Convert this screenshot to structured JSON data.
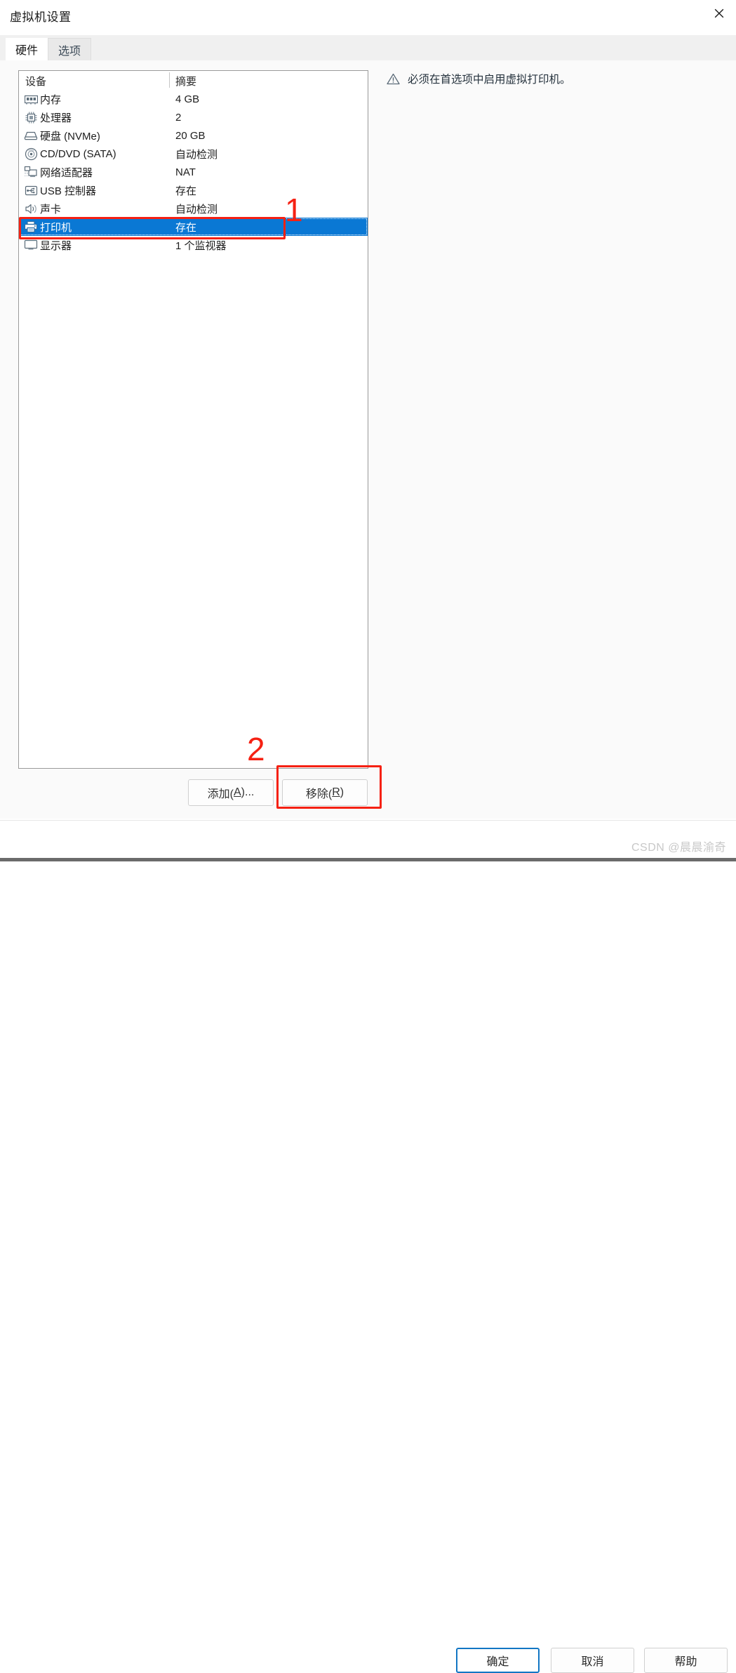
{
  "window": {
    "title": "虚拟机设置",
    "close_icon": "close-icon"
  },
  "tabs": [
    {
      "label": "硬件",
      "active": true
    },
    {
      "label": "选项",
      "active": false
    }
  ],
  "device_list": {
    "columns": {
      "device": "设备",
      "summary": "摘要"
    },
    "rows": [
      {
        "icon": "memory-icon",
        "name": "内存",
        "summary": "4 GB",
        "selected": false
      },
      {
        "icon": "processor-icon",
        "name": "处理器",
        "summary": "2",
        "selected": false
      },
      {
        "icon": "harddisk-icon",
        "name": "硬盘 (NVMe)",
        "summary": "20 GB",
        "selected": false
      },
      {
        "icon": "cddvd-icon",
        "name": "CD/DVD (SATA)",
        "summary": "自动检测",
        "selected": false
      },
      {
        "icon": "network-icon",
        "name": "网络适配器",
        "summary": "NAT",
        "selected": false
      },
      {
        "icon": "usb-icon",
        "name": "USB 控制器",
        "summary": "存在",
        "selected": false
      },
      {
        "icon": "sound-icon",
        "name": "声卡",
        "summary": "自动检测",
        "selected": false
      },
      {
        "icon": "printer-icon",
        "name": "打印机",
        "summary": "存在",
        "selected": true
      },
      {
        "icon": "display-icon",
        "name": "显示器",
        "summary": "1 个监视器",
        "selected": false
      }
    ]
  },
  "notice": {
    "icon": "warning-triangle-icon",
    "text": "必须在首选项中启用虚拟打印机。"
  },
  "list_buttons": {
    "add": {
      "prefix": "添加(",
      "accel": "A",
      "suffix": ")..."
    },
    "remove": {
      "prefix": "移除(",
      "accel": "R",
      "suffix": ")"
    }
  },
  "footer_buttons": {
    "ok": "确定",
    "cancel": "取消",
    "help": "帮助"
  },
  "annotations": {
    "marker_one": "1",
    "marker_two": "2",
    "color": "#f52113"
  },
  "watermark": "CSDN @晨晨渝奇",
  "colors": {
    "selection_blue": "#0a78d4",
    "default_button_border": "#1276c4",
    "annotation_red": "#f52113"
  }
}
